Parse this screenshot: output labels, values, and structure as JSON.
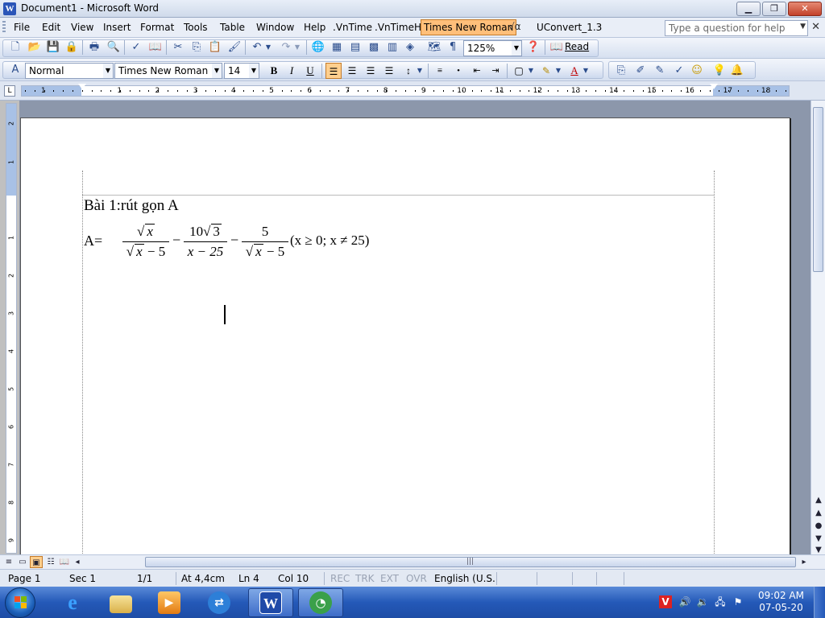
{
  "window": {
    "title": "Document1 - Microsoft Word"
  },
  "menu": {
    "items": [
      "File",
      "Edit",
      "View",
      "Insert",
      "Format",
      "Tools",
      "Table",
      "Window",
      "Help",
      ".VnTime",
      ".VnTimeH",
      "Times New Roman",
      "UConvert_1.3"
    ],
    "highlighted": "Times New Roman",
    "help_placeholder": "Type a question for help"
  },
  "toolbar_standard": {
    "zoom": "125%",
    "read_label": "Read"
  },
  "toolbar_formatting": {
    "style": "Normal",
    "font": "Times New Roman",
    "size": "14",
    "bold": "B",
    "italic": "I",
    "underline": "U"
  },
  "ruler": {
    "h_labels": [
      "1",
      "1",
      "2",
      "3",
      "4",
      "5",
      "6",
      "7",
      "8",
      "9",
      "10",
      "11",
      "12",
      "13",
      "14",
      "15",
      "16",
      "17",
      "18"
    ],
    "v_labels": [
      "2",
      "1",
      "1",
      "2",
      "3",
      "4",
      "5",
      "6",
      "7",
      "8",
      "9"
    ]
  },
  "document": {
    "line1": "Bài 1:rút gọn A",
    "label": "A=",
    "frac1_num": "x",
    "frac1_den_rad": "x",
    "frac1_den_rest": " − 5",
    "minus1": "−",
    "frac2_num_coef": "10",
    "frac2_num_rad": "3",
    "frac2_den": "x − 25",
    "minus2": "−",
    "frac3_num": "5",
    "frac3_den_rad": "x",
    "frac3_den_rest": " − 5",
    "condition": "(x ≥ 0; x ≠ 25)"
  },
  "status": {
    "page": "Page  1",
    "sec": "Sec  1",
    "pages": "1/1",
    "at": "At  4,4cm",
    "ln": "Ln  4",
    "col": "Col  10",
    "rec": "REC",
    "trk": "TRK",
    "ext": "EXT",
    "ovr": "OVR",
    "lang": "English (U.S."
  },
  "taskbar": {
    "time": "09:02 AM",
    "date": "07-05-20"
  },
  "colors": {
    "menu_highlight": "#ffbf7a",
    "taskbar": "#2459b8",
    "ruler_margin": "#a8c1e6"
  }
}
